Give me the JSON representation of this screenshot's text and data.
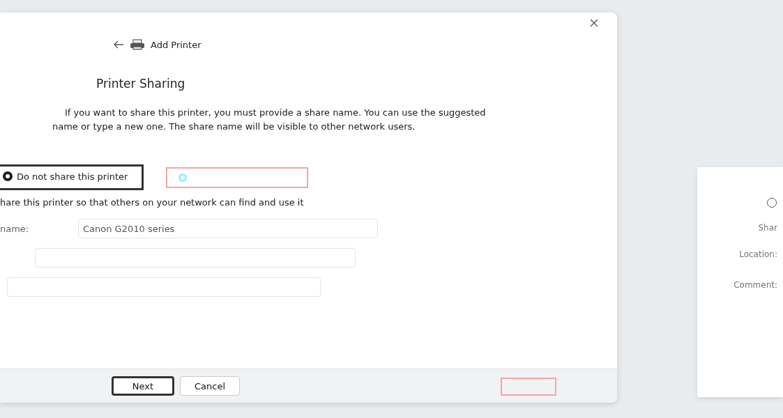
{
  "window": {
    "title": "Add Printer"
  },
  "heading": "Printer Sharing",
  "description": "If you want to share this printer, you must provide a share name. You can use the suggested name or type a new one. The share name will be visible to other network users.",
  "options": [
    {
      "label": "Do not share this printer",
      "selected": true
    },
    {
      "label": "hare this printer so that others on your network can find and use it",
      "selected": false
    }
  ],
  "share_name": {
    "label": "name:",
    "value": "Canon G2010 series"
  },
  "buttons": [
    {
      "label": "Next",
      "default": true
    },
    {
      "label": "Cancel",
      "default": false
    }
  ],
  "side_panel": {
    "options": [
      {
        "selected": false
      }
    ],
    "labels": [
      "Shar",
      "Location:",
      "Comment:"
    ]
  }
}
